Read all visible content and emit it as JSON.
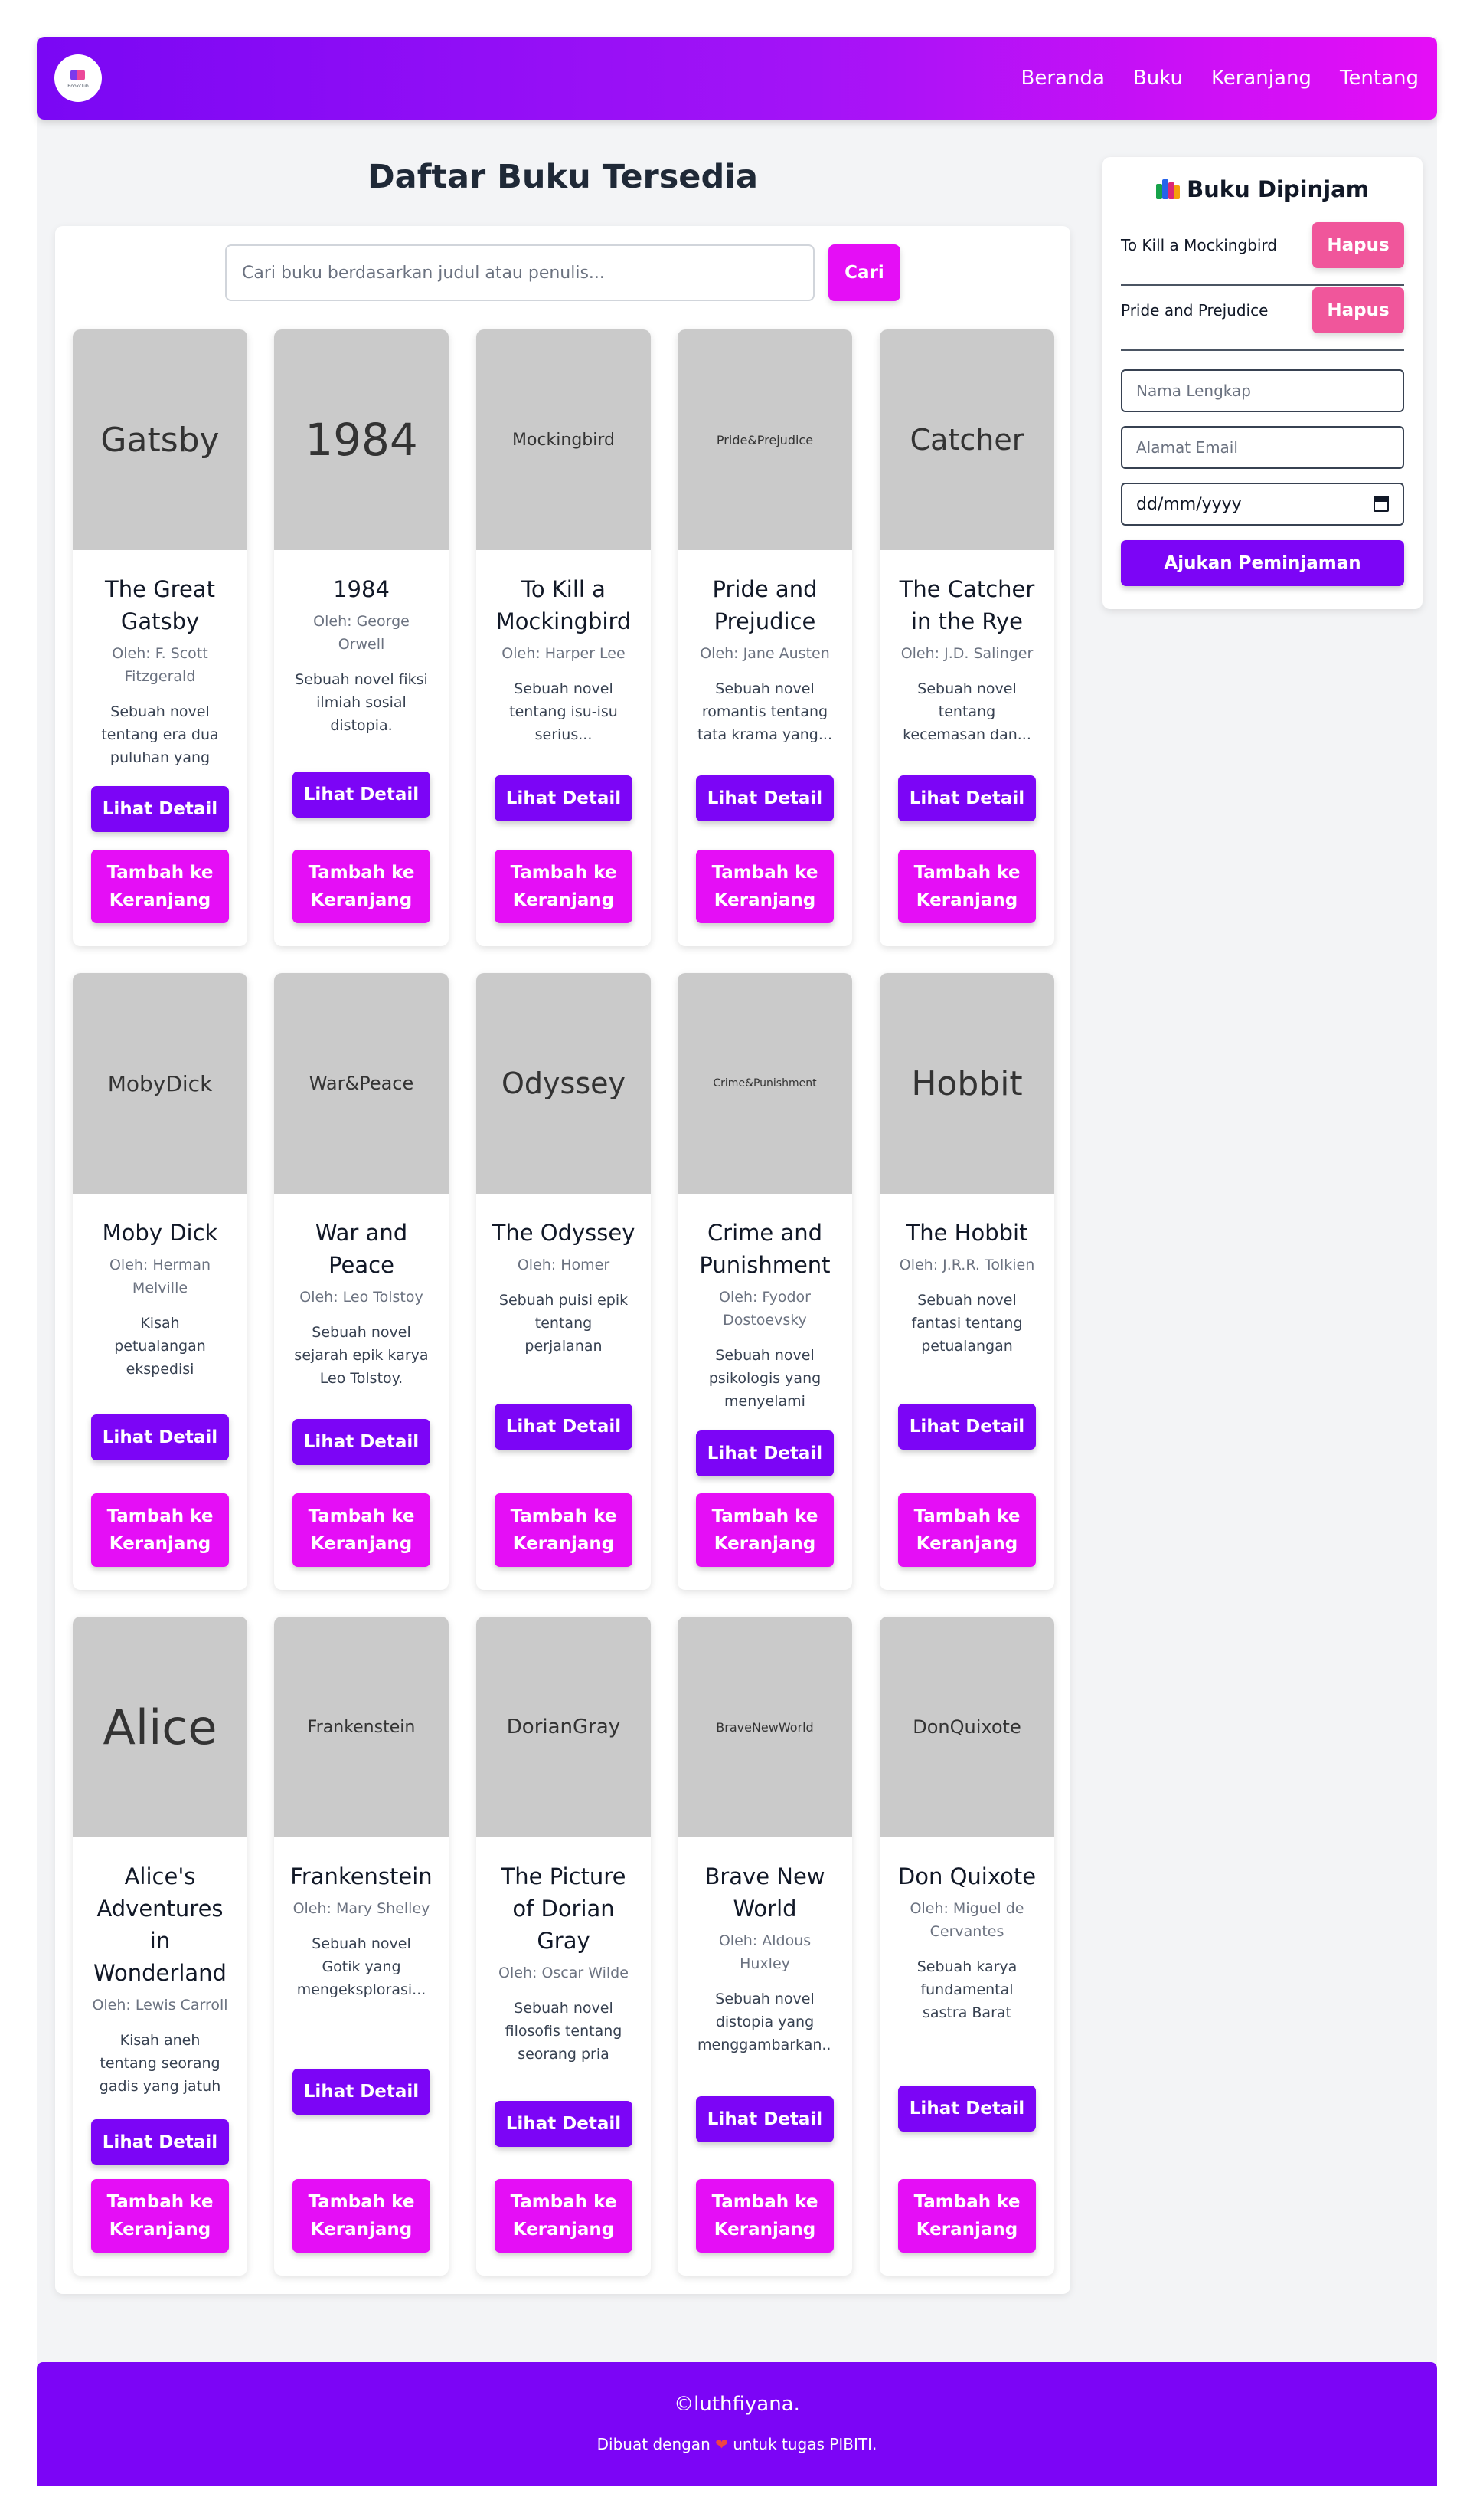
{
  "nav": {
    "logo_text": "Bookclub",
    "links": [
      "Beranda",
      "Buku",
      "Keranjang",
      "Tentang"
    ]
  },
  "main": {
    "title": "Daftar Buku Tersedia",
    "search_placeholder": "Cari buku berdasarkan judul atau penulis...",
    "search_button": "Cari"
  },
  "labels": {
    "detail": "Lihat Detail",
    "cart": "Tambah ke Keranjang"
  },
  "books": [
    {
      "cover": "Gatsby",
      "title": "The Great Gatsby",
      "author": "Oleh: F. Scott Fitzgerald",
      "desc": "Sebuah novel tentang era dua puluhan yang"
    },
    {
      "cover": "1984",
      "title": "1984",
      "author": "Oleh: George Orwell",
      "desc": "Sebuah novel fiksi ilmiah sosial distopia."
    },
    {
      "cover": "Mockingbird",
      "title": "To Kill a Mockingbird",
      "author": "Oleh: Harper Lee",
      "desc": "Sebuah novel tentang isu-isu serius..."
    },
    {
      "cover": "Pride&Prejudice",
      "title": "Pride and Prejudice",
      "author": "Oleh: Jane Austen",
      "desc": "Sebuah novel romantis tentang tata krama yang..."
    },
    {
      "cover": "Catcher",
      "title": "The Catcher in the Rye",
      "author": "Oleh: J.D. Salinger",
      "desc": "Sebuah novel tentang kecemasan dan..."
    },
    {
      "cover": "MobyDick",
      "title": "Moby Dick",
      "author": "Oleh: Herman Melville",
      "desc": "Kisah petualangan ekspedisi perburuan paus."
    },
    {
      "cover": "War&Peace",
      "title": "War and Peace",
      "author": "Oleh: Leo Tolstoy",
      "desc": "Sebuah novel sejarah epik karya Leo Tolstoy."
    },
    {
      "cover": "Odyssey",
      "title": "The Odyssey",
      "author": "Oleh: Homer",
      "desc": "Sebuah puisi epik tentang perjalanan panjang pahlawa..."
    },
    {
      "cover": "Crime&Punishment",
      "title": "Crime and Punishment",
      "author": "Oleh: Fyodor Dostoevsky",
      "desc": "Sebuah novel psikologis yang menyelami dilem..."
    },
    {
      "cover": "Hobbit",
      "title": "The Hobbit",
      "author": "Oleh: J.R.R. Tolkien",
      "desc": "Sebuah novel fantasi tentang petualangan Bilb..."
    },
    {
      "cover": "Alice",
      "title": "Alice's Adventures in Wonderland",
      "author": "Oleh: Lewis Carroll",
      "desc": "Kisah aneh tentang seorang gadis yang jatuh ke..."
    },
    {
      "cover": "Frankenstein",
      "title": "Frankenstein",
      "author": "Oleh: Mary Shelley",
      "desc": "Sebuah novel Gotik yang mengeksplorasi..."
    },
    {
      "cover": "DorianGray",
      "title": "The Picture of Dorian Gray",
      "author": "Oleh: Oscar Wilde",
      "desc": "Sebuah novel filosofis tentang seorang pria yan..."
    },
    {
      "cover": "BraveNewWorld",
      "title": "Brave New World",
      "author": "Oleh: Aldous Huxley",
      "desc": "Sebuah novel distopia yang menggambarkan..."
    },
    {
      "cover": "DonQuixote",
      "title": "Don Quixote",
      "author": "Oleh: Miguel de Cervantes",
      "desc": "Sebuah karya fundamental sastra Barat modern,..."
    }
  ],
  "sidebar": {
    "title": "Buku Dipinjam",
    "icon": "books-icon",
    "borrowed": [
      {
        "title": "To Kill a Mockingbird",
        "button": "Hapus"
      },
      {
        "title": "Pride and Prejudice",
        "button": "Hapus"
      }
    ],
    "name_placeholder": "Nama Lengkap",
    "email_placeholder": "Alamat Email",
    "date_value": "dd/mm/yyyy",
    "submit": "Ajukan Peminjaman"
  },
  "footer": {
    "copyright": "©luthfiyana.",
    "made_prefix": "Dibuat dengan",
    "heart": "❤",
    "made_suffix": "untuk tugas PIBITI."
  },
  "colors": {
    "primary": "#7c05f6",
    "accent": "#e50ef6",
    "delete": "#f0569b",
    "cover": "#cacaca"
  }
}
